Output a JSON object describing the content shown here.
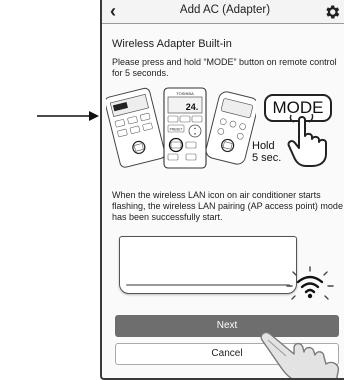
{
  "header": {
    "title": "Add AC (Adapter)",
    "back_icon": "chevron-left-icon",
    "settings_icon": "gear-icon"
  },
  "content": {
    "section_title": "Wireless Adapter Built-in",
    "instruction": "Please press and hold “MODE” button on remote control for 5 seconds.",
    "mode_key_label": "MODE",
    "hold_line1": "Hold",
    "hold_line2": "5 sec.",
    "remote_brand": "TOSHIBA",
    "remote_display_value": "24.",
    "remote_preset_label": "PRESET",
    "remote_mode_label": "MODE",
    "pairing_note": "When the wireless LAN icon on air conditioner starts flashing, the wireless LAN pairing (AP access point) mode has been successfully start."
  },
  "actions": {
    "next_label": "Next",
    "cancel_label": "Cancel"
  },
  "colors": {
    "next_button_bg": "#6e6e6e",
    "page_bg": "#fafafa"
  }
}
